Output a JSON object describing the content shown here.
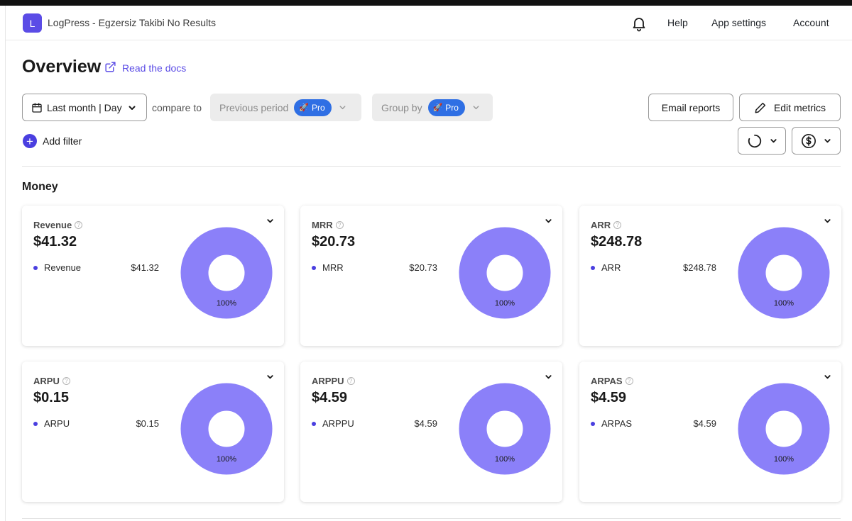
{
  "app": {
    "logo_letter": "L",
    "title": "LogPress - Egzersiz Takibi No Results"
  },
  "nav": {
    "help": "Help",
    "app_settings": "App settings",
    "account": "Account"
  },
  "page": {
    "title": "Overview",
    "docs_link": "Read the docs"
  },
  "controls": {
    "date_range": "Last month | Day",
    "compare_to": "compare to",
    "previous_period": "Previous period",
    "group_by": "Group by",
    "pro_badge": "Pro",
    "email_reports": "Email reports",
    "edit_metrics": "Edit metrics",
    "add_filter": "Add filter"
  },
  "colors": {
    "accent": "#5b4ce6",
    "donut": "#8b80f9",
    "pro_badge": "#2f6fe4"
  },
  "money": {
    "section_title": "Money",
    "cards": [
      {
        "label": "Revenue",
        "value": "$41.32",
        "legend_label": "Revenue",
        "legend_value": "$41.32",
        "percent": "100%"
      },
      {
        "label": "MRR",
        "value": "$20.73",
        "legend_label": "MRR",
        "legend_value": "$20.73",
        "percent": "100%"
      },
      {
        "label": "ARR",
        "value": "$248.78",
        "legend_label": "ARR",
        "legend_value": "$248.78",
        "percent": "100%"
      },
      {
        "label": "ARPU",
        "value": "$0.15",
        "legend_label": "ARPU",
        "legend_value": "$0.15",
        "percent": "100%"
      },
      {
        "label": "ARPPU",
        "value": "$4.59",
        "legend_label": "ARPPU",
        "legend_value": "$4.59",
        "percent": "100%"
      },
      {
        "label": "ARPAS",
        "value": "$4.59",
        "legend_label": "ARPAS",
        "legend_value": "$4.59",
        "percent": "100%"
      }
    ]
  }
}
